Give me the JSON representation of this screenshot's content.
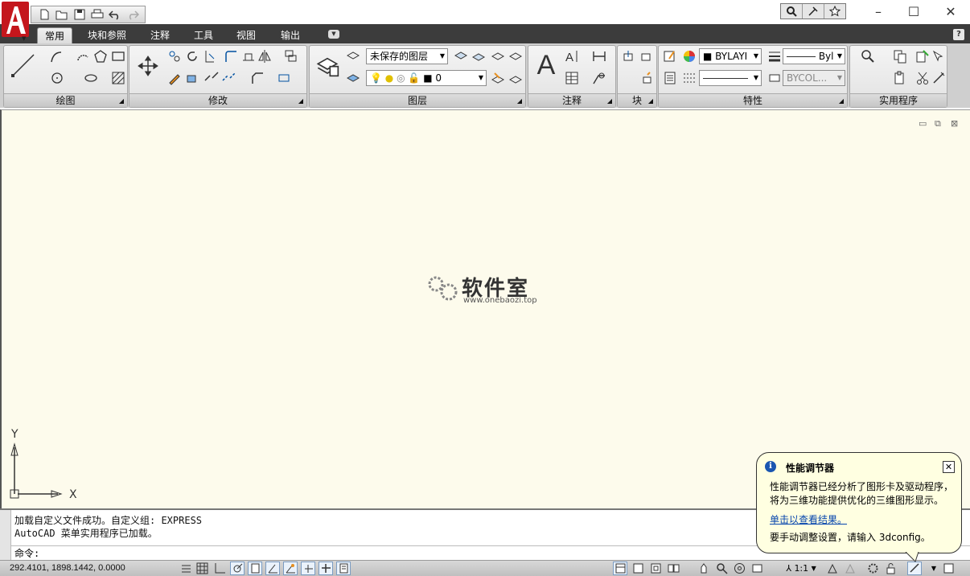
{
  "app": {
    "logo_letter": "A",
    "accent": "#c4161c"
  },
  "tabs": [
    {
      "label": "常用",
      "active": true
    },
    {
      "label": "块和参照"
    },
    {
      "label": "注释"
    },
    {
      "label": "工具"
    },
    {
      "label": "视图"
    },
    {
      "label": "输出"
    }
  ],
  "help_label": "?",
  "ribbon": {
    "panels": {
      "draw": "绘图",
      "modify": "修改",
      "layers": "图层",
      "annotation": "注释",
      "block": "块",
      "properties": "特性",
      "utilities": "实用程序"
    },
    "layer_state": "未保存的图层",
    "current_layer": "0",
    "color": "BYLAYI",
    "linetype": "Byl",
    "plotstyle": "BYCOL..."
  },
  "watermark": {
    "name": "软件室",
    "url": "www.onebaozi.top"
  },
  "ucs": {
    "y": "Y",
    "x": "X"
  },
  "command": {
    "lines": [
      "加载自定义文件成功。自定义组: EXPRESS",
      "AutoCAD 菜单实用程序已加载。"
    ],
    "prompt": "命令:"
  },
  "status": {
    "coords": "292.4101,  1898.1442,  0.0000",
    "scale": "1:1"
  },
  "balloon": {
    "title": "性能调节器",
    "body": "性能调节器已经分析了图形卡及驱动程序，将为三维功能提供优化的三维图形显示。",
    "link": "单击以查看结果。",
    "footer": "要手动调整设置，请输入 3dconfig。"
  }
}
